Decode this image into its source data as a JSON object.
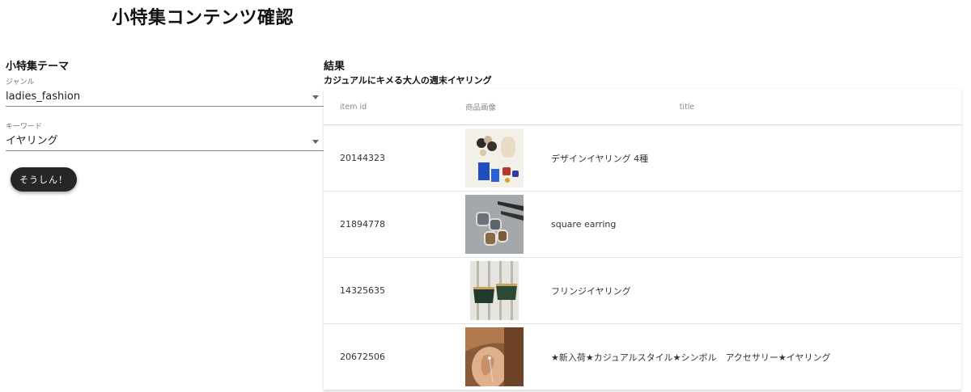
{
  "page": {
    "title": "小特集コンテンツ確認"
  },
  "form": {
    "section_title": "小特集テーマ",
    "genre": {
      "label": "ジャンル",
      "value": "ladies_fashion"
    },
    "keyword": {
      "label": "キーワード",
      "value": "イヤリング"
    },
    "submit_label": "そうしん！"
  },
  "results": {
    "title": "結果",
    "theme": "カジュアルにキメる大人の週末イヤリング",
    "columns": {
      "item_id": "item id",
      "image": "商品画像",
      "title": "title"
    },
    "rows": [
      {
        "item_id": "20144323",
        "title": "デザインイヤリング 4種",
        "image": "earrings-photo"
      },
      {
        "item_id": "21894778",
        "title": "square earring",
        "image": "earrings-photo"
      },
      {
        "item_id": "14325635",
        "title": "フリンジイヤリング",
        "image": "earrings-photo"
      },
      {
        "item_id": "20672506",
        "title": "★新入荷★カジュアルスタイル★シンボル　アクセサリー★イヤリング",
        "image": "earrings-photo"
      }
    ]
  },
  "colors": {
    "button_bg": "#262626",
    "text": "#222222",
    "muted": "#888888"
  }
}
